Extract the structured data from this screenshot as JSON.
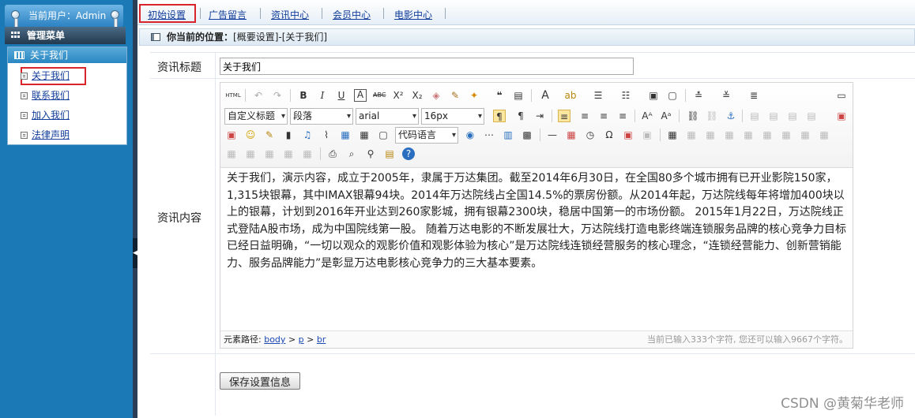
{
  "sidebar": {
    "user_label": "当前用户：Admin",
    "menu_title": "管理菜单",
    "panel_title": "关于我们",
    "items": [
      {
        "label": "关于我们"
      },
      {
        "label": "联系我们"
      },
      {
        "label": "加入我们"
      },
      {
        "label": "法律声明"
      }
    ]
  },
  "topnav": {
    "tabs": [
      {
        "label": "初始设置"
      },
      {
        "label": "广告留言"
      },
      {
        "label": "资讯中心"
      },
      {
        "label": "会员中心"
      },
      {
        "label": "电影中心"
      }
    ]
  },
  "breadcrumb": {
    "prefix": "你当前的位置：",
    "path": "[概要设置]-[关于我们]"
  },
  "form": {
    "title_label": "资讯标题",
    "title_value": "关于我们",
    "content_label": "资讯内容",
    "save_label": "保存设置信息"
  },
  "editor": {
    "html_button": "HTML",
    "custom_title_select": "自定义标题",
    "paragraph_select": "段落",
    "font_select": "arial",
    "size_select": "16px",
    "code_lang_select": "代码语言",
    "content": "关于我们，演示内容，成立于2005年，隶属于万达集团。截至2014年6月30日，在全国80多个城市拥有已开业影院150家，1,315块银幕，其中IMAX银幕94块。2014年万达院线占全国14.5%的票房份额。从2014年起，万达院线每年将增加400块以上的银幕，计划到2016年开业达到260家影城，拥有银幕2300块，稳居中国第一的市场份额。 2015年1月22日，万达院线正式登陆A股市场，成为中国院线第一股。 随着万达电影的不断发展壮大，万达院线打造电影终端连锁服务品牌的核心竞争力目标已经日益明确，“一切以观众的观影价值和观影体验为核心”是万达院线连锁经营服务的核心理念，“连锁经营能力、创新营销能力、服务品牌能力”是彰显万达电影核心竞争力的三大基本要素。",
    "path_label": "元素路径:",
    "path_items": [
      "body",
      "p",
      "br"
    ],
    "path_sep": ">",
    "char_count": "当前已输入333个字符, 您还可以输入9667个字符。"
  },
  "watermark": "CSDN @黄菊华老师",
  "colors": {
    "sidebar_bg": "#1b79b5",
    "highlight_box": "#d9242a",
    "link": "#123d9a"
  }
}
